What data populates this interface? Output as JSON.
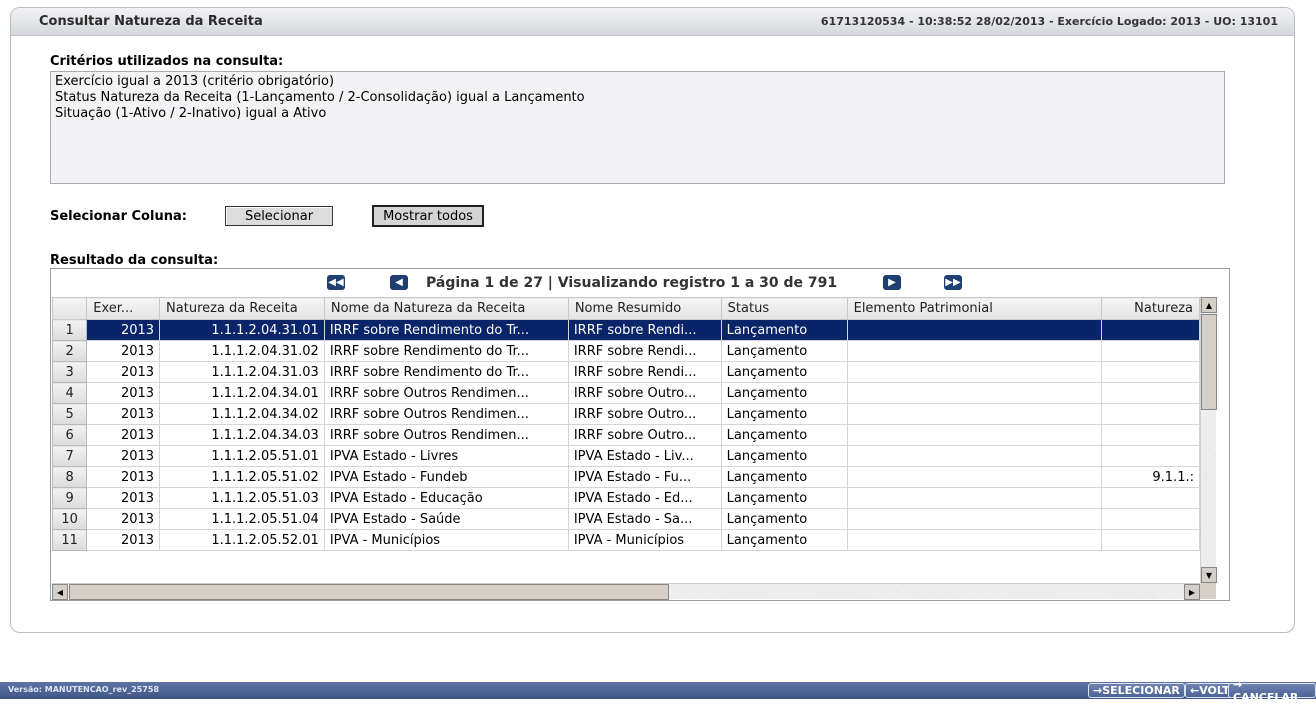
{
  "header": {
    "title": "Consultar Natureza da Receita",
    "info": "61713120534 - 10:38:52 28/02/2013 - Exercício Logado: 2013 - UO: 13101"
  },
  "criteria": {
    "label": "Critérios utilizados na consulta:",
    "lines": [
      "Exercício igual a 2013 (critério obrigatório)",
      "Status Natureza da Receita (1-Lançamento / 2-Consolidação) igual a Lançamento",
      "Situação (1-Ativo / 2-Inativo) igual a Ativo"
    ]
  },
  "select_column": {
    "label": "Selecionar Coluna:",
    "select_button": "Selecionar",
    "show_all_button": "Mostrar todos"
  },
  "results": {
    "label": "Resultado da consulta:",
    "pager_text": "Página 1 de 27 | Visualizando registro 1 a 30 de 791",
    "columns": [
      "",
      "Exer...",
      "Natureza da Receita",
      "Nome da Natureza da Receita",
      "Nome Resumido",
      "Status",
      "Elemento Patrimonial",
      "Natureza"
    ],
    "rows": [
      [
        "1",
        "2013",
        "1.1.1.2.04.31.01",
        "IRRF sobre Rendimento do Tr...",
        "IRRF sobre Rendi...",
        "Lançamento",
        "",
        ""
      ],
      [
        "2",
        "2013",
        "1.1.1.2.04.31.02",
        "IRRF sobre Rendimento do Tr...",
        "IRRF sobre Rendi...",
        "Lançamento",
        "",
        ""
      ],
      [
        "3",
        "2013",
        "1.1.1.2.04.31.03",
        "IRRF sobre Rendimento do Tr...",
        "IRRF sobre Rendi...",
        "Lançamento",
        "",
        ""
      ],
      [
        "4",
        "2013",
        "1.1.1.2.04.34.01",
        "IRRF sobre Outros Rendimen...",
        "IRRF sobre Outro...",
        "Lançamento",
        "",
        ""
      ],
      [
        "5",
        "2013",
        "1.1.1.2.04.34.02",
        "IRRF sobre Outros Rendimen...",
        "IRRF sobre Outro...",
        "Lançamento",
        "",
        ""
      ],
      [
        "6",
        "2013",
        "1.1.1.2.04.34.03",
        "IRRF sobre Outros Rendimen...",
        "IRRF sobre Outro...",
        "Lançamento",
        "",
        ""
      ],
      [
        "7",
        "2013",
        "1.1.1.2.05.51.01",
        "IPVA Estado - Livres",
        "IPVA Estado - Liv...",
        "Lançamento",
        "",
        ""
      ],
      [
        "8",
        "2013",
        "1.1.1.2.05.51.02",
        "IPVA Estado - Fundeb",
        "IPVA Estado - Fu...",
        "Lançamento",
        "",
        "9.1.1.:"
      ],
      [
        "9",
        "2013",
        "1.1.1.2.05.51.03",
        "IPVA Estado - Educação",
        "IPVA Estado - Ed...",
        "Lançamento",
        "",
        ""
      ],
      [
        "10",
        "2013",
        "1.1.1.2.05.51.04",
        "IPVA Estado - Saúde",
        "IPVA Estado - Sa...",
        "Lançamento",
        "",
        ""
      ],
      [
        "11",
        "2013",
        "1.1.1.2.05.52.01",
        "IPVA - Municípios",
        "IPVA - Municípios",
        "Lançamento",
        "",
        ""
      ]
    ],
    "selected_row": 0
  },
  "footer": {
    "version": "Versão: MANUTENCAO_rev_25758",
    "buttons": [
      "→SELECIONAR",
      "←VOLTAR",
      "→ CANCELAR"
    ]
  },
  "colors": {
    "selected_row": "#0a246a",
    "pager_buttons": "#1f3f73",
    "footer_bar": "#4a6194"
  },
  "icons": [
    "first-page-icon",
    "previous-page-icon",
    "next-page-icon",
    "last-page-icon"
  ]
}
